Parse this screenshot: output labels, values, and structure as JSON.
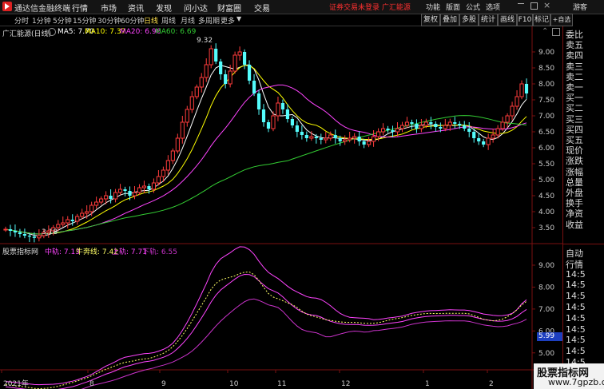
{
  "titlebar": {
    "app_name": "通达信金融终端",
    "menu": [
      "行情",
      "市场",
      "资讯",
      "发现",
      "问小达",
      "财富圈",
      "交易"
    ],
    "notice": "证券交易未登录  广汇能源",
    "system": [
      "功能",
      "版面",
      "公式",
      "选项",
      "游客"
    ]
  },
  "toolbar": {
    "periods": [
      "分时",
      "1分钟",
      "5分钟",
      "15分钟",
      "30分钟",
      "60分钟",
      "日线",
      "周线",
      "月线",
      "多周期",
      "更多"
    ],
    "active_period": "日线",
    "buttons": [
      "复权",
      "叠加",
      "多股",
      "统计",
      "画线",
      "F10",
      "标记",
      "+自选"
    ]
  },
  "main_chart": {
    "stock_title": "广汇能源(日线)",
    "ma_legend": [
      {
        "label": "MA5: 7.70",
        "color": "#ffffff"
      },
      {
        "label": "MA10: 7.37",
        "color": "#ffff00"
      },
      {
        "label": "MA20: 6.96",
        "color": "#ff44ff"
      },
      {
        "label": "MA60: 6.69",
        "color": "#33cc33"
      }
    ],
    "high_label": "9.32",
    "low_label": "3.18",
    "y_ticks": [
      "9.00",
      "8.50",
      "8.00",
      "7.50",
      "7.00",
      "6.50",
      "6.00",
      "5.50",
      "5.00",
      "4.50",
      "4.00",
      "3.50"
    ],
    "y_range": [
      3.1,
      9.5
    ]
  },
  "indicator": {
    "name": "股票指标网",
    "legend": [
      {
        "label": "中轨: 7.13",
        "color": "#ff44ff"
      },
      {
        "label": "牛奔线: 7.42",
        "color": "#ffff66"
      },
      {
        "label": "上轨: 7.71",
        "color": "#ff44ff"
      },
      {
        "label": "下轨: 6.55",
        "color": "#cc33cc"
      }
    ],
    "y_ticks": [
      "9.00",
      "8.00",
      "7.00",
      "6.00",
      "5.00"
    ],
    "y_range": [
      4.3,
      9.4
    ],
    "current_tag": "5.99"
  },
  "x_axis": [
    "2021年",
    "8",
    "9",
    "10",
    "11",
    "12",
    "1",
    "2"
  ],
  "right_panel": {
    "items": [
      "委比",
      "卖五",
      "卖四",
      "卖三",
      "卖二",
      "卖一",
      "买一",
      "买二",
      "买三",
      "买四",
      "买五",
      "现价",
      "涨跌",
      "涨幅",
      "总量",
      "外盘",
      "换手",
      "净资",
      "收益"
    ],
    "lower_items": [
      "自动",
      "行情",
      "14:5",
      "14:5",
      "14:5",
      "14:5",
      "14:5",
      "14:5",
      "14:5",
      "14:5",
      "14:5"
    ]
  },
  "watermark": {
    "line1": "股票指标网",
    "line2": "www.7gpzb.com"
  },
  "chart_data": {
    "type": "candlestick",
    "closes": [
      3.45,
      3.4,
      3.35,
      3.3,
      3.25,
      3.22,
      3.18,
      3.25,
      3.35,
      3.4,
      3.5,
      3.6,
      3.65,
      3.75,
      3.7,
      3.85,
      3.95,
      4.0,
      4.2,
      4.3,
      4.4,
      4.5,
      4.4,
      4.6,
      4.7,
      4.65,
      4.5,
      4.6,
      4.75,
      4.8,
      4.7,
      4.9,
      5.1,
      5.3,
      5.6,
      5.9,
      6.3,
      6.8,
      7.2,
      7.6,
      7.9,
      8.2,
      8.6,
      9.1,
      8.7,
      8.3,
      8.0,
      8.4,
      8.9,
      9.0,
      8.6,
      8.1,
      7.7,
      7.2,
      6.8,
      6.6,
      7.0,
      7.4,
      7.2,
      6.9,
      6.7,
      6.5,
      6.4,
      6.3,
      6.35,
      6.3,
      6.25,
      6.3,
      6.4,
      6.3,
      6.2,
      6.25,
      6.3,
      6.35,
      6.2,
      6.1,
      6.2,
      6.35,
      6.5,
      6.6,
      6.55,
      6.5,
      6.6,
      6.7,
      6.8,
      6.75,
      6.6,
      6.7,
      6.8,
      6.75,
      6.65,
      6.6,
      6.7,
      6.8,
      6.75,
      6.7,
      6.6,
      6.5,
      6.3,
      6.2,
      6.1,
      6.3,
      6.4,
      6.6,
      6.8,
      7.0,
      7.3,
      7.6,
      8.0,
      7.7
    ]
  }
}
